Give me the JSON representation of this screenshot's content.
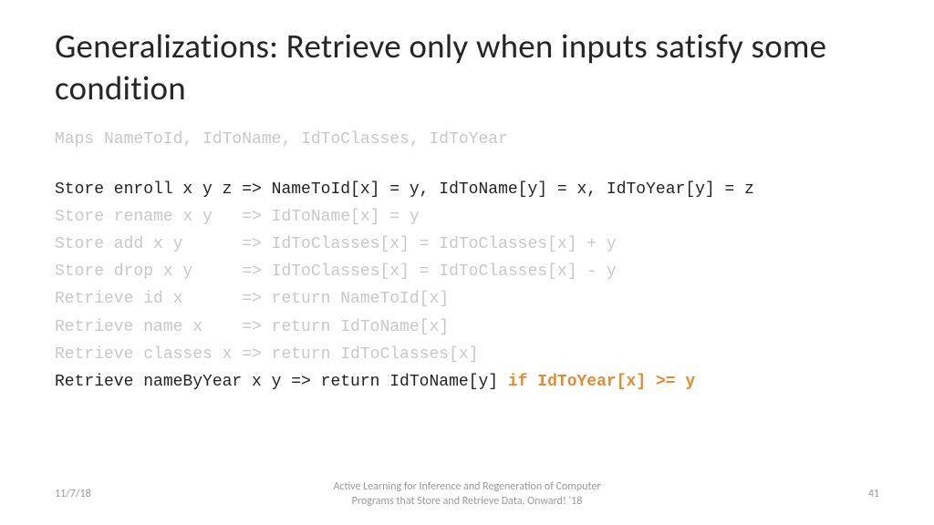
{
  "title": "Generalizations: Retrieve only when inputs satisfy some condition",
  "maps_line": "Maps NameToId, IdToName, IdToClasses, IdToYear",
  "code": {
    "l1": "Store enroll x y z => NameToId[x] = y, IdToName[y] = x, IdToYear[y] = z",
    "l2": "Store rename x y   => IdToName[x] = y",
    "l3": "Store add x y      => IdToClasses[x] = IdToClasses[x] + y",
    "l4": "Store drop x y     => IdToClasses[x] = IdToClasses[x] - y",
    "l5": "Retrieve id x      => return NameToId[x]",
    "l6": "Retrieve name x    => return IdToName[x]",
    "l7": "Retrieve classes x => return IdToClasses[x]",
    "l8a": "Retrieve nameByYear x y => return IdToName[y] ",
    "l8b": "if IdToYear[x] >= y"
  },
  "footer": {
    "date": "11/7/18",
    "center1": "Active Learning for Inference and Regeneration of Computer",
    "center2": "Programs that Store and Retrieve Data. Onward! '18",
    "page": "41"
  }
}
